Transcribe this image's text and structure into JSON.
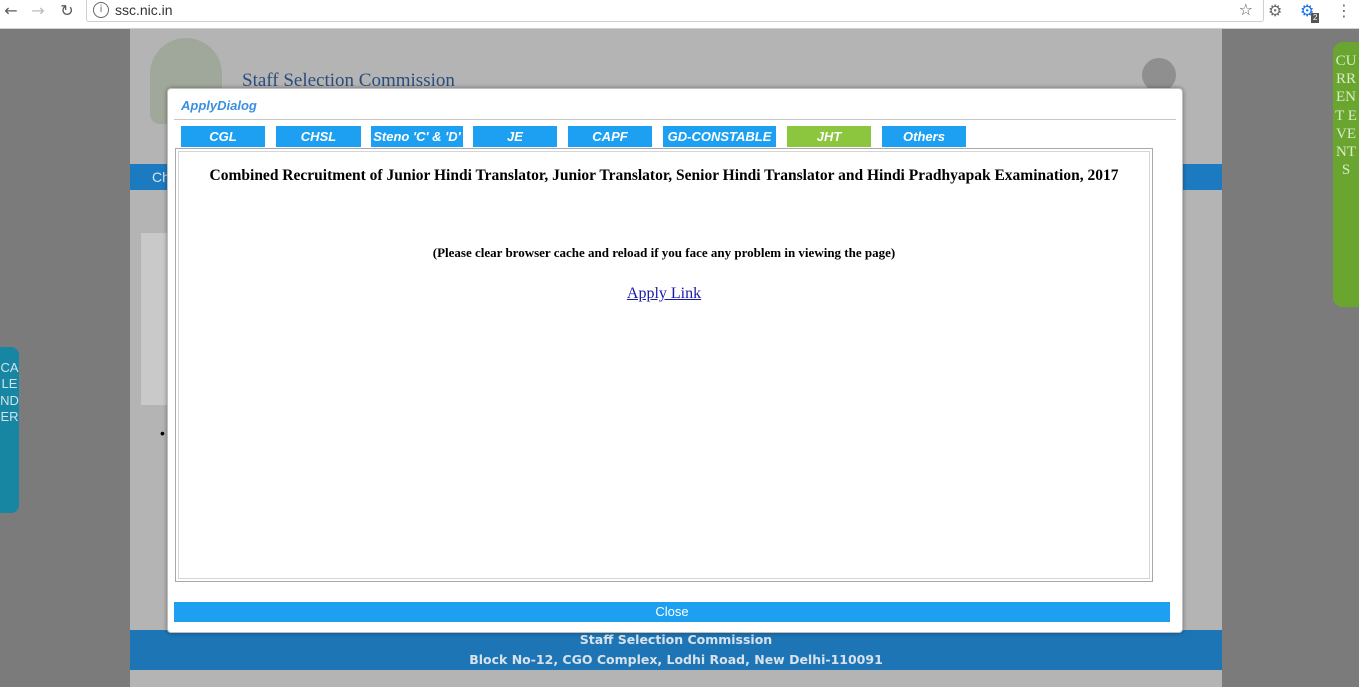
{
  "browser": {
    "back": "←",
    "forward": "→",
    "reload": "↻",
    "info": "i",
    "url": "ssc.nic.in",
    "star": "☆",
    "ext1": "⚙",
    "ext2": "⚙",
    "ext2_badge": "2",
    "menu": "⋮"
  },
  "page": {
    "site_title": "Staff Selection Commission",
    "band_text": "Ch",
    "bullet": "•",
    "footer_line1": "Staff Selection Commission",
    "footer_line2": "Block No-12, CGO Complex, Lodhi Road, New Delhi-110091"
  },
  "side_tabs": {
    "left": "CALENDER",
    "right": "CURRENT EVENTS"
  },
  "dialog": {
    "title": "ApplyDialog",
    "tabs": [
      {
        "label": "CGL",
        "active": false
      },
      {
        "label": "CHSL",
        "active": false
      },
      {
        "label": "Steno 'C' & 'D'",
        "active": false
      },
      {
        "label": "JE",
        "active": false
      },
      {
        "label": "CAPF",
        "active": false
      },
      {
        "label": "GD-CONSTABLE",
        "active": false
      },
      {
        "label": "JHT",
        "active": true
      },
      {
        "label": "Others",
        "active": false
      }
    ],
    "heading": "Combined Recruitment of Junior Hindi Translator, Junior Translator, Senior Hindi Translator and Hindi Pradhyapak Examination, 2017",
    "note": "(Please clear browser cache and reload if you face any problem in viewing the page)",
    "apply_link": "Apply Link",
    "close_label": "Close"
  },
  "colors": {
    "tab_blue": "#1da0f2",
    "tab_active_green": "#8cc63f",
    "footer_blue": "#1d75b5"
  }
}
